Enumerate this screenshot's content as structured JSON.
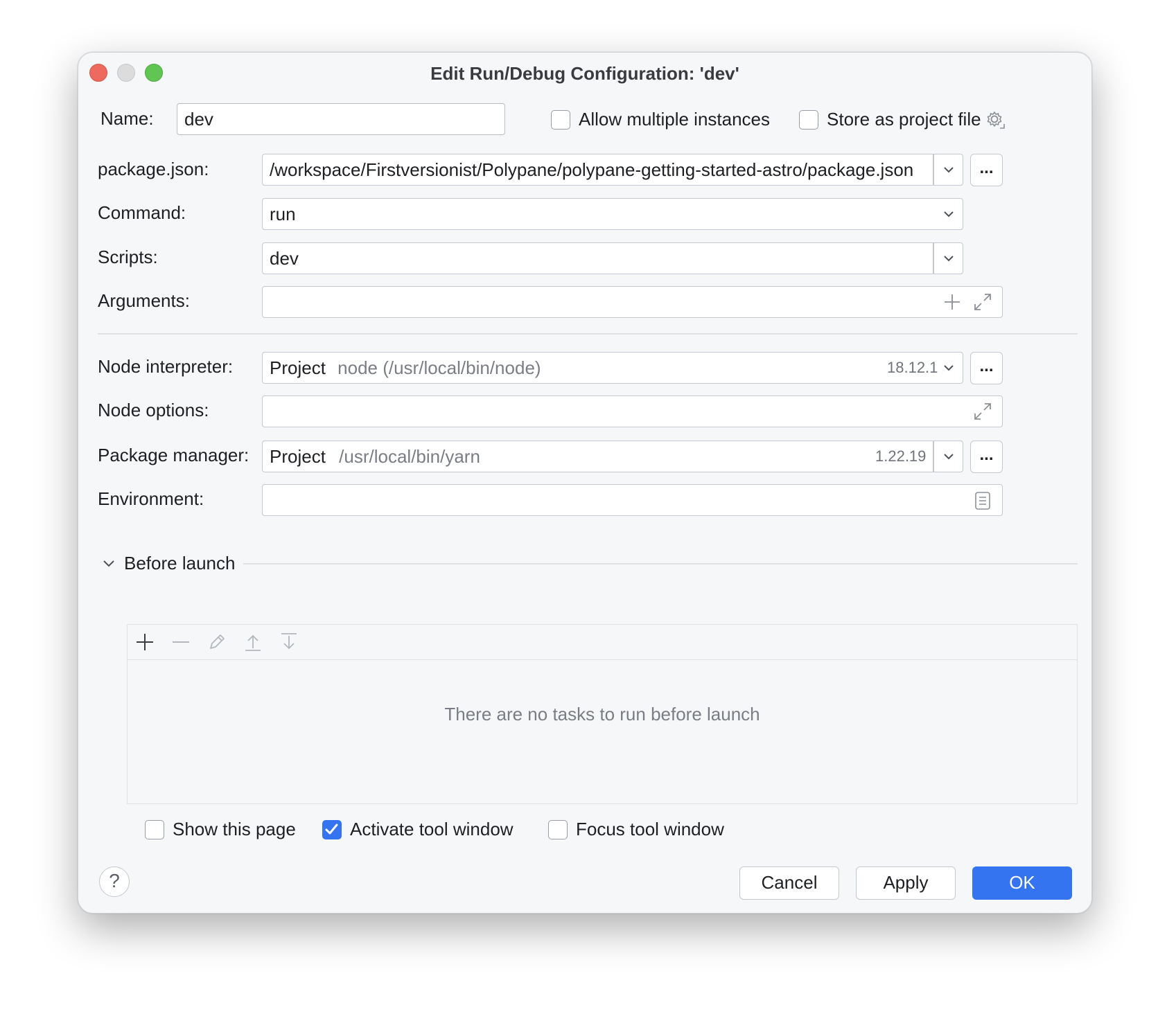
{
  "window": {
    "title": "Edit Run/Debug Configuration: 'dev'"
  },
  "name_row": {
    "label": "Name:",
    "value": "dev",
    "allow_multiple": {
      "label": "Allow multiple instances",
      "checked": false
    },
    "store_project": {
      "label": "Store as project file",
      "checked": false
    }
  },
  "form": {
    "package_json": {
      "label": "package.json:",
      "value": "/workspace/Firstversionist/Polypane/polypane-getting-started-astro/package.json",
      "browse": "..."
    },
    "command": {
      "label": "Command:",
      "value": "run"
    },
    "scripts": {
      "label": "Scripts:",
      "value": "dev"
    },
    "arguments": {
      "label": "Arguments:",
      "value": ""
    },
    "node_interpreter": {
      "label": "Node interpreter:",
      "prefix": "Project",
      "value": "node (/usr/local/bin/node)",
      "version": "18.12.1",
      "browse": "..."
    },
    "node_options": {
      "label": "Node options:",
      "value": ""
    },
    "package_manager": {
      "label": "Package manager:",
      "prefix": "Project",
      "value": "/usr/local/bin/yarn",
      "version": "1.22.19",
      "browse": "..."
    },
    "environment": {
      "label": "Environment:",
      "value": ""
    }
  },
  "before_launch": {
    "title": "Before launch",
    "empty_text": "There are no tasks to run before launch",
    "show_page": {
      "label": "Show this page",
      "checked": false
    },
    "activate_tool": {
      "label": "Activate tool window",
      "checked": true
    },
    "focus_tool": {
      "label": "Focus tool window",
      "checked": false
    }
  },
  "buttons": {
    "help": "?",
    "cancel": "Cancel",
    "apply": "Apply",
    "ok": "OK"
  },
  "colors": {
    "accent": "#3574f0",
    "close": "#ed6a5e",
    "minimize": "#dcdcdc",
    "maximize": "#61c554"
  }
}
